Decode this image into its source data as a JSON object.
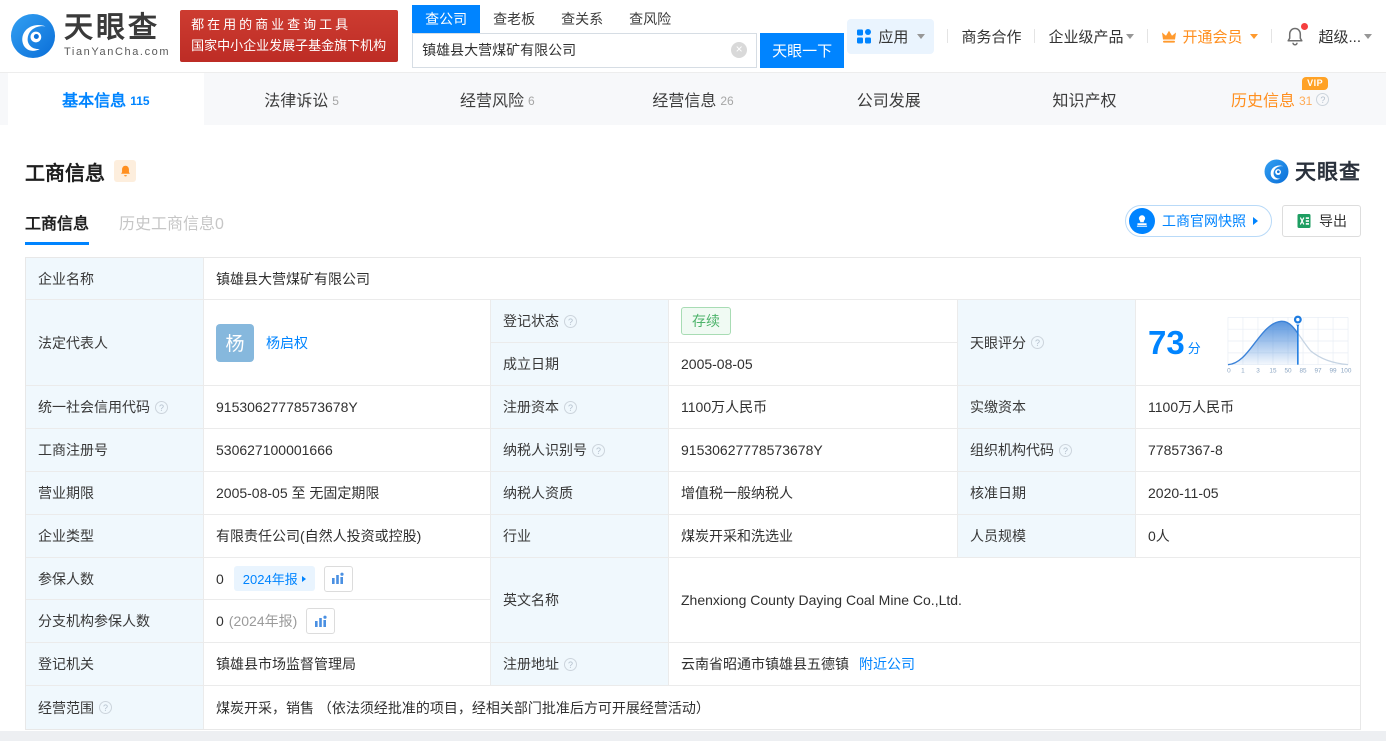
{
  "brand_color": "#0084ff",
  "header": {
    "logo": {
      "brand": "天眼查",
      "domain": "TianYanCha.com"
    },
    "banner": {
      "line1": "都在用的商业查询工具",
      "line2": "国家中小企业发展子基金旗下机构"
    },
    "search": {
      "tabs": [
        {
          "label": "查公司"
        },
        {
          "label": "查老板"
        },
        {
          "label": "查关系"
        },
        {
          "label": "查风险"
        }
      ],
      "value": "镇雄县大营煤矿有限公司",
      "button": "天眼一下"
    },
    "menu": {
      "apps": "应用",
      "cooperation": "商务合作",
      "enterprise": "企业级产品",
      "vip": "开通会员",
      "super": "超级..."
    }
  },
  "nav_tabs": [
    {
      "label": "基本信息",
      "count": "115"
    },
    {
      "label": "法律诉讼",
      "count": "5"
    },
    {
      "label": "经营风险",
      "count": "6"
    },
    {
      "label": "经营信息",
      "count": "26"
    },
    {
      "label": "公司发展",
      "count": ""
    },
    {
      "label": "知识产权",
      "count": ""
    },
    {
      "label": "历史信息",
      "count": "31",
      "vip_badge": "VIP"
    }
  ],
  "section": {
    "title": "工商信息",
    "watermark": "天眼查",
    "subtabs": [
      {
        "label": "工商信息"
      },
      {
        "label": "历史工商信息0"
      }
    ],
    "snapshot_button": "工商官网快照",
    "export_button": "导出"
  },
  "table": {
    "row_name": {
      "label": "企业名称",
      "value": "镇雄县大营煤矿有限公司"
    },
    "row_legal": {
      "label": "法定代表人",
      "avatar": "杨",
      "name": "杨启权"
    },
    "row_status": {
      "label": "登记状态",
      "value": "存续"
    },
    "row_established": {
      "label": "成立日期",
      "value": "2005-08-05"
    },
    "row_score": {
      "label": "天眼评分",
      "score": "73",
      "unit": "分"
    },
    "rows": [
      [
        {
          "l": "统一社会信用代码",
          "v": "91530627778573678Y"
        },
        {
          "l": "注册资本",
          "v": "1100万人民币"
        },
        {
          "l": "实缴资本",
          "v": "1100万人民币"
        }
      ],
      [
        {
          "l": "工商注册号",
          "v": "530627100001666"
        },
        {
          "l": "纳税人识别号",
          "v": "91530627778573678Y"
        },
        {
          "l": "组织机构代码",
          "v": "77857367-8"
        }
      ],
      [
        {
          "l": "营业期限",
          "v": "2005-08-05 至 无固定期限"
        },
        {
          "l": "纳税人资质",
          "v": "增值税一般纳税人"
        },
        {
          "l": "核准日期",
          "v": "2020-11-05"
        }
      ],
      [
        {
          "l": "企业类型",
          "v": "有限责任公司(自然人投资或控股)"
        },
        {
          "l": "行业",
          "v": "煤炭开采和洗选业"
        },
        {
          "l": "人员规模",
          "v": "0人"
        }
      ]
    ],
    "row_insured": {
      "label": "参保人数",
      "value": "0",
      "badge": "2024年报"
    },
    "row_branch": {
      "label": "分支机构参保人数",
      "value": "0",
      "note": "(2024年报)"
    },
    "row_english": {
      "label": "英文名称",
      "value": "Zhenxiong County Daying Coal Mine Co.,Ltd."
    },
    "row_authority": {
      "label": "登记机关",
      "value": "镇雄县市场监督管理局"
    },
    "row_address": {
      "label": "注册地址",
      "value": "云南省昭通市镇雄县五德镇",
      "link": "附近公司"
    },
    "row_scope": {
      "label": "经营范围",
      "value": "煤炭开采，销售 （依法须经批准的项目，经相关部门批准后方可开展经营活动）"
    }
  },
  "chart_data": {
    "type": "area",
    "title": "天眼评分",
    "score": 73,
    "unit": "分",
    "x_tick_labels": [
      "0",
      "1",
      "3",
      "15",
      "50",
      "85",
      "97",
      "99",
      "100"
    ],
    "marker_value": 73,
    "legend": "blue filled distribution curve up to score marker, gray tail after"
  }
}
